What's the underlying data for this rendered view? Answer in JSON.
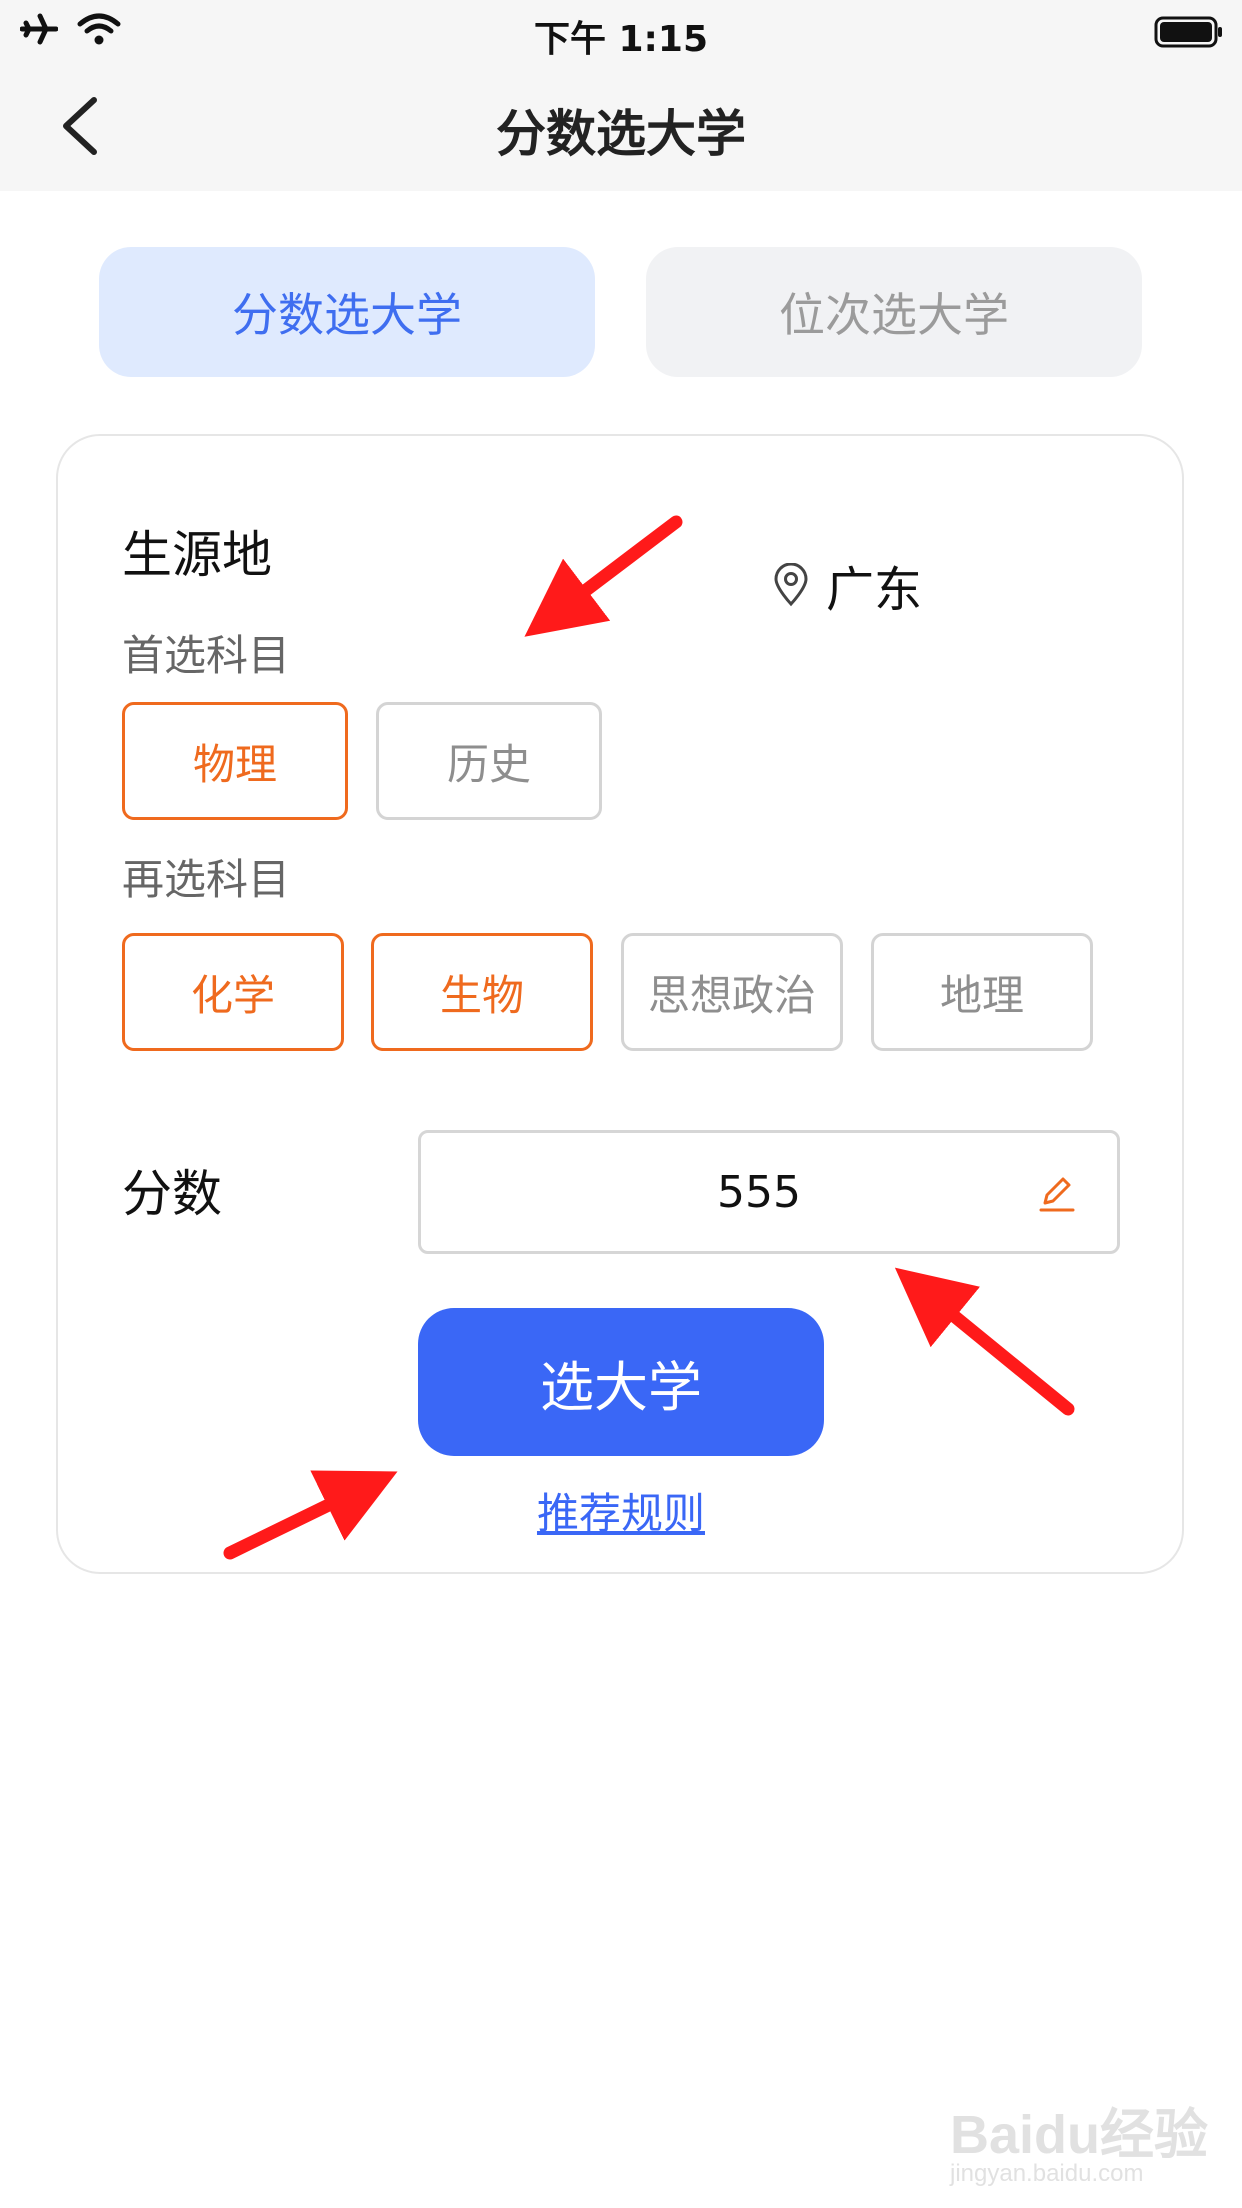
{
  "status_bar": {
    "time": "下午 1:15"
  },
  "nav": {
    "title": "分数选大学"
  },
  "tabs": [
    {
      "label": "分数选大学",
      "active": true
    },
    {
      "label": "位次选大学",
      "active": false
    }
  ],
  "form": {
    "origin_label": "生源地",
    "origin_value": "广东",
    "first_subject_label": "首选科目",
    "first_subjects": [
      {
        "label": "物理",
        "selected": true
      },
      {
        "label": "历史",
        "selected": false
      }
    ],
    "second_subject_label": "再选科目",
    "second_subjects": [
      {
        "label": "化学",
        "selected": true
      },
      {
        "label": "生物",
        "selected": true
      },
      {
        "label": "思想政治",
        "selected": false
      },
      {
        "label": "地理",
        "selected": false
      }
    ],
    "score_label": "分数",
    "score_value": "555",
    "submit_label": "选大学",
    "rules_link": "推荐规则"
  },
  "watermark": {
    "brand": "Baidu经验",
    "url": "jingyan.baidu.com"
  },
  "colors": {
    "accent_blue": "#3a67f6",
    "accent_orange": "#ef6a1e",
    "tab_active_bg": "#dfeafe",
    "annotation_red": "#ff1a1a"
  }
}
